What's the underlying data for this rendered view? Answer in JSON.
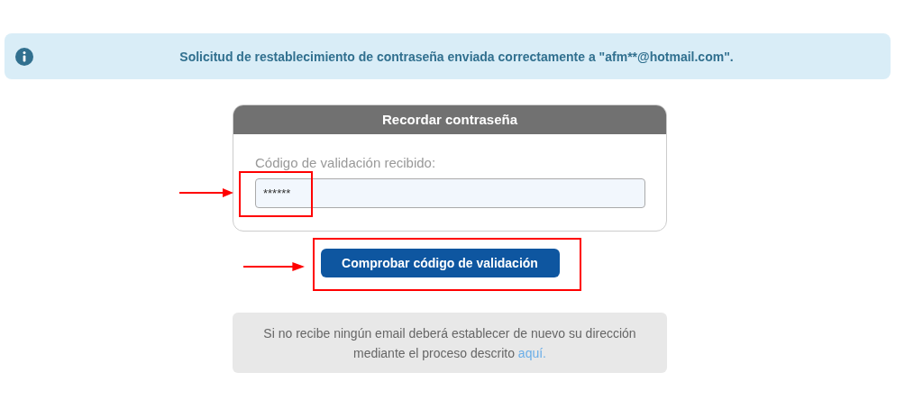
{
  "alert": {
    "text": "Solicitud de restablecimiento de contraseña enviada correctamente a \"afm**@hotmail.com\"."
  },
  "card": {
    "title": "Recordar contraseña",
    "field_label": "Código de validación recibido:",
    "field_value": "******"
  },
  "button": "Comprobar código de validación",
  "note": {
    "text": "Si no recibe ningún email deberá establecer de nuevo su dirección mediante el proceso descrito ",
    "link": "aquí."
  },
  "annotations": [
    {
      "kind": "box"
    },
    {
      "kind": "arrow"
    },
    {
      "kind": "box"
    },
    {
      "kind": "arrow"
    }
  ]
}
